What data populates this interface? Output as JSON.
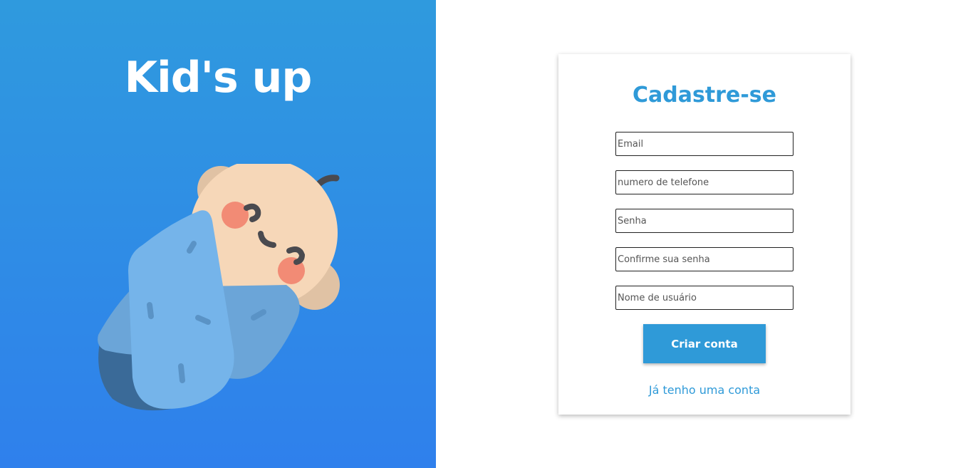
{
  "brand": {
    "title": "Kid's up"
  },
  "illustration": {
    "icon": "swaddled-baby-illustration"
  },
  "signup": {
    "title": "Cadastre-se",
    "fields": [
      {
        "placeholder": "Email",
        "value": ""
      },
      {
        "placeholder": "numero de telefone",
        "value": ""
      },
      {
        "placeholder": "Senha",
        "value": ""
      },
      {
        "placeholder": "Confirme sua senha",
        "value": ""
      },
      {
        "placeholder": "Nome de usuário",
        "value": ""
      }
    ],
    "submit_label": "Criar conta",
    "login_link": "Já tenho uma conta"
  },
  "colors": {
    "gradient_top": "#2f9ade",
    "gradient_bottom": "#2f80ec",
    "accent": "#2f9ad8"
  }
}
